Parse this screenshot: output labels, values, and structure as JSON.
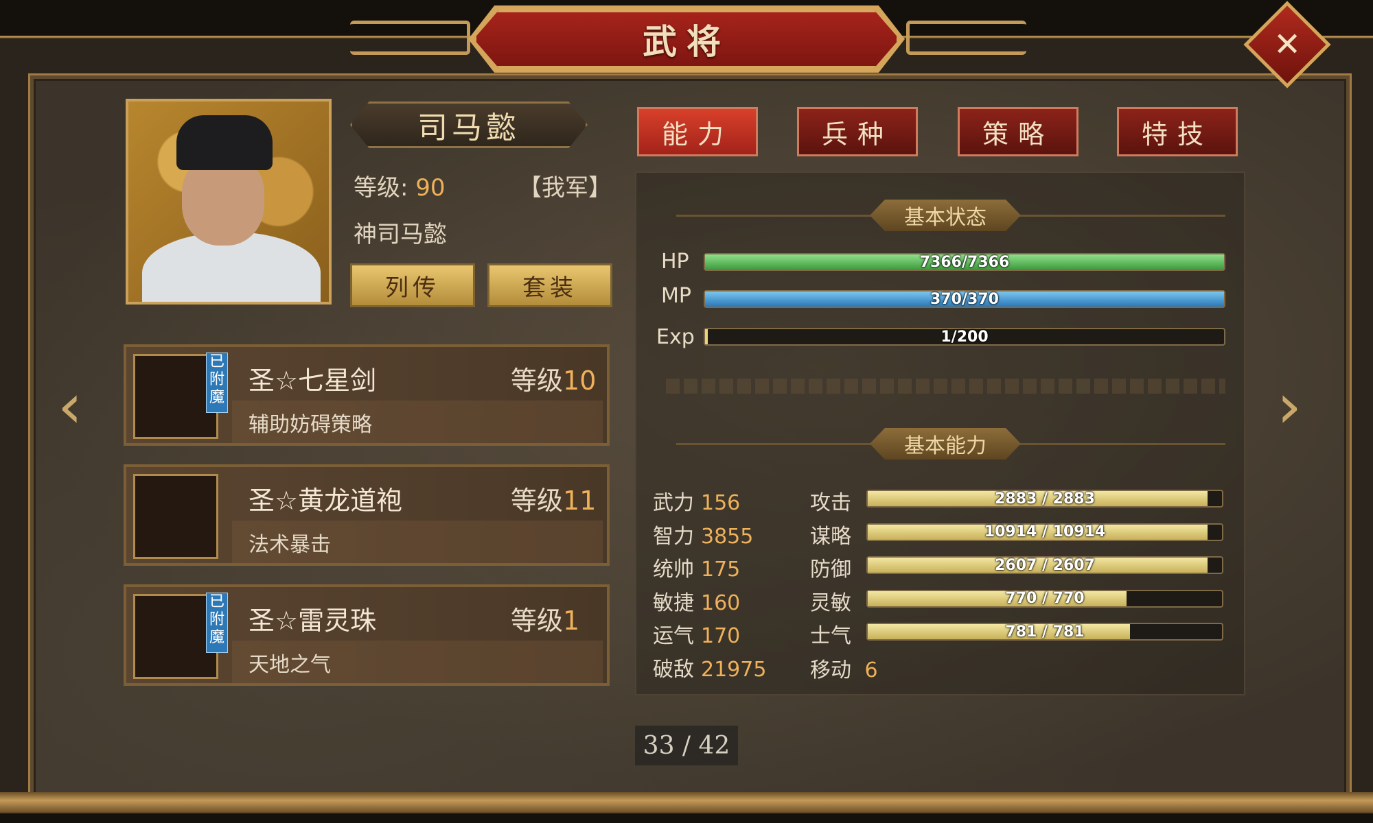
{
  "title": "武将",
  "hero": {
    "name": "司马懿",
    "level_label": "等级:",
    "level": "90",
    "faction": "【我军】",
    "title": "神司马懿",
    "btn_biography": "列传",
    "btn_set": "套装"
  },
  "tabs": [
    {
      "label": "能力",
      "active": true
    },
    {
      "label": "兵种",
      "active": false
    },
    {
      "label": "策略",
      "active": false
    },
    {
      "label": "特技",
      "active": false
    }
  ],
  "status": {
    "title": "基本状态",
    "hp": {
      "label": "HP",
      "text": "7366/7366",
      "fill": 1.0
    },
    "mp": {
      "label": "MP",
      "text": "370/370",
      "fill": 1.0
    },
    "exp": {
      "label": "Exp",
      "text": "1/200",
      "fill": 0.005
    }
  },
  "abilities": {
    "title": "基本能力",
    "left": [
      {
        "name": "武力",
        "value": "156"
      },
      {
        "name": "智力",
        "value": "3855"
      },
      {
        "name": "统帅",
        "value": "175"
      },
      {
        "name": "敏捷",
        "value": "160"
      },
      {
        "name": "运气",
        "value": "170"
      },
      {
        "name": "破敌",
        "value": "21975"
      }
    ],
    "right": [
      {
        "name": "攻击",
        "text": "2883 / 2883",
        "fill": 0.96
      },
      {
        "name": "谋略",
        "text": "10914 / 10914",
        "fill": 0.96
      },
      {
        "name": "防御",
        "text": "2607 / 2607",
        "fill": 0.96
      },
      {
        "name": "灵敏",
        "text": "770 / 770",
        "fill": 0.73
      },
      {
        "name": "士气",
        "text": "781 / 781",
        "fill": 0.74
      }
    ],
    "move": {
      "name": "移动",
      "value": "6"
    }
  },
  "equipment": [
    {
      "name": "圣☆七星剑",
      "level_label": "等级",
      "level": "10",
      "skill": "辅助妨碍策略",
      "enchanted": "已附魔",
      "icon": "sword-icon"
    },
    {
      "name": "圣☆黄龙道袍",
      "level_label": "等级",
      "level": "11",
      "skill": "法术暴击",
      "enchanted": "",
      "icon": "robe-icon"
    },
    {
      "name": "圣☆雷灵珠",
      "level_label": "等级",
      "level": "1",
      "skill": "天地之气",
      "enchanted": "已附魔",
      "icon": "orb-icon"
    }
  ],
  "pagination": {
    "text": "33 / 42",
    "current": 33,
    "total": 42
  },
  "colors": {
    "accent": "#efb15a",
    "hp": "#5fc25f",
    "mp": "#3c9fd8",
    "gold_bar": "#e8d47a",
    "tab_active": "#d8402a"
  }
}
